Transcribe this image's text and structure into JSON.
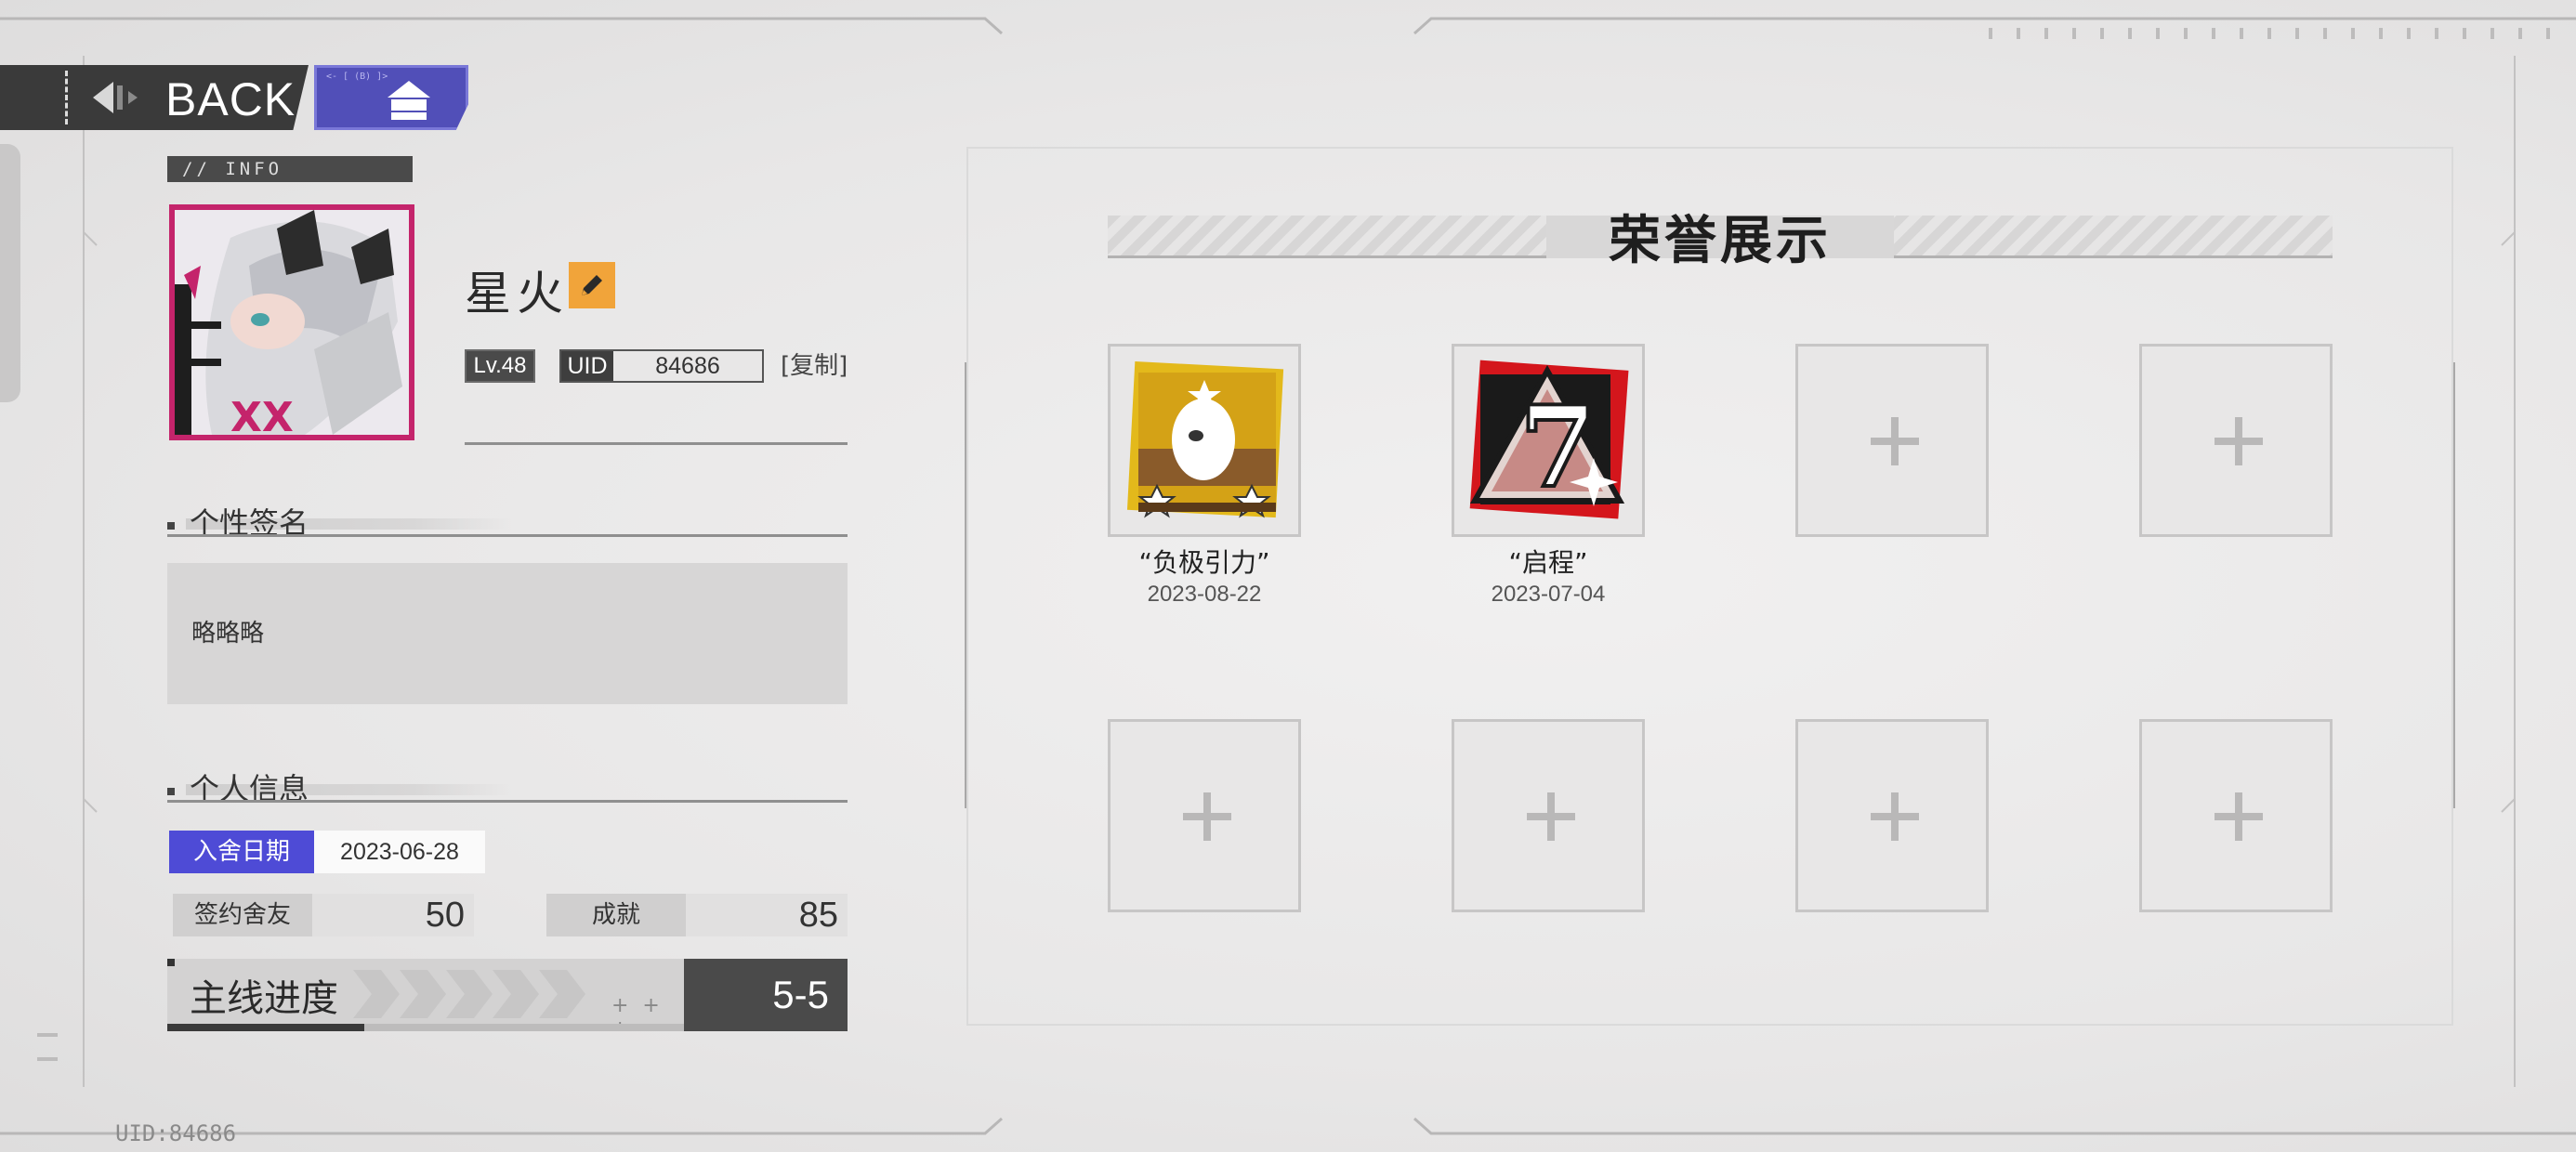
{
  "nav": {
    "back_label": "BACK",
    "home_tiny": "<- [ (B) ]>"
  },
  "profile": {
    "info_tag": "// INFO",
    "name": "星火",
    "level": "Lv.48",
    "uid_label": "UID",
    "uid_value": "84686",
    "copy_label": "[复制]"
  },
  "signature_section": {
    "title": "个性签名",
    "text": "略略略"
  },
  "personal_info": {
    "title": "个人信息",
    "join_label": "入舍日期",
    "join_date": "2023-06-28",
    "stats": [
      {
        "label": "签约舍友",
        "value": "50"
      },
      {
        "label": "成就",
        "value": "85"
      }
    ],
    "progress_label": "主线进度",
    "progress_decor": "+ + +",
    "progress_value": "5-5"
  },
  "footer": {
    "uid": "UID:84686"
  },
  "honors": {
    "title": "荣誉展示",
    "badges": [
      {
        "name": "“负极引力”",
        "date": "2023-08-22"
      },
      {
        "name": "“启程”",
        "date": "2023-07-04"
      }
    ],
    "empty_slots": 6
  },
  "colors": {
    "accent_purple": "#514fb8",
    "join_purple": "#4e4bd6",
    "edit_orange": "#f1a43a",
    "avatar_border": "#c4246b",
    "dark": "#4a4a4a"
  }
}
